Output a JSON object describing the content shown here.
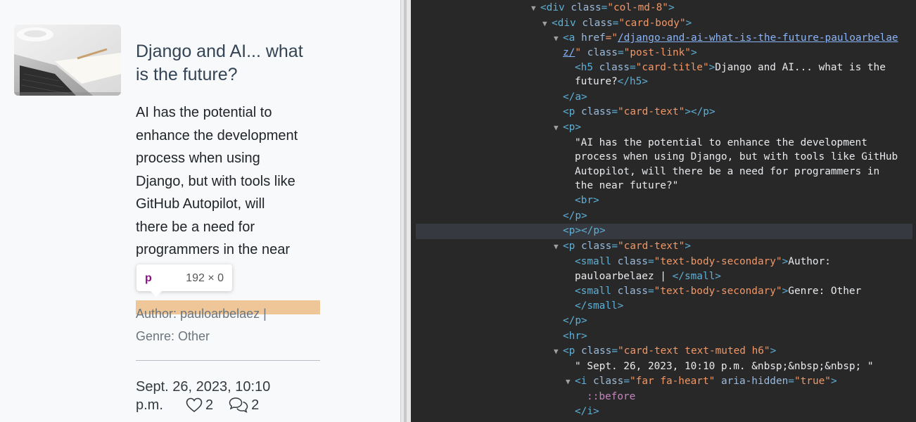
{
  "post": {
    "image_alt": "laptop with notebook and pencil on desk",
    "title_line1": "Django and AI... what",
    "title_line2": "is the future?",
    "body_lines": [
      "AI has the potential to",
      "enhance the development",
      "process when using",
      "Django, but with tools like",
      "GitHub Autopilot, will",
      "there be a need for",
      "programmers in the near"
    ],
    "author_line": "Author: pauloarbelaez |",
    "genre_line": "Genre: Other",
    "date_line1": "Sept. 26, 2023, 10:10",
    "date_line2": "p.m.",
    "likes": "2",
    "comments": "2"
  },
  "tooltip": {
    "tag": "p",
    "dims": "192 × 0"
  },
  "devtools": {
    "lines": {
      "l1_tag": "<div ",
      "l1_attr": "class",
      "l1_val": "\"col-md-8\"",
      "l1_end": ">",
      "l2_tag": "<div ",
      "l2_attr": "class",
      "l2_val": "\"card-body\"",
      "l2_end": ">",
      "l3_tag": "<a ",
      "l3_attr": "href",
      "l3_eq": "=\"",
      "l3_link": "/django-and-ai-what-is-the-future-pauloarbelae",
      "l4_link": "z/",
      "l4_q": "\" ",
      "l4_attr": "class",
      "l4_val": "\"post-link\"",
      "l4_end": ">",
      "l5_tag": "<h5 ",
      "l5_attr": "class",
      "l5_val": "\"card-title\"",
      "l5_end": ">",
      "l5_text": "Django and AI... what is the",
      "l6_text": "future?",
      "l6_end": "</h5>",
      "l7": "</a>",
      "l8_tag": "<p ",
      "l8_attr": "class",
      "l8_val": "\"card-text\"",
      "l8_end": "></p>",
      "l9": "<p>",
      "l10": "\"AI has the potential to enhance the development",
      "l11": "process when using Django, but with tools like GitHub",
      "l12": "Autopilot, will there be a need for programmers in",
      "l13": "the near future?\"",
      "l14": "<br>",
      "l15": "</p>",
      "l16": "<p></p>",
      "l17_tag": "<p ",
      "l17_attr": "class",
      "l17_val": "\"card-text\"",
      "l17_end": ">",
      "l18_tag": "<small ",
      "l18_attr": "class",
      "l18_val": "\"text-body-secondary\"",
      "l18_end": ">",
      "l18_text": "Author:",
      "l19_text": "pauloarbelaez | ",
      "l19_end": "</small>",
      "l20_tag": "<small ",
      "l20_attr": "class",
      "l20_val": "\"text-body-secondary\"",
      "l20_end": ">",
      "l20_text": "Genre: Other",
      "l21": "</small>",
      "l22": "</p>",
      "l23": "<hr>",
      "l24_tag": "<p ",
      "l24_attr": "class",
      "l24_val": "\"card-text text-muted h6\"",
      "l24_end": ">",
      "l25": "\" Sept. 26, 2023, 10:10 p.m. &nbsp;&nbsp;&nbsp; \"",
      "l26_tag": "<i ",
      "l26_attr": "class",
      "l26_val": "\"far fa-heart\"",
      "l26_attr2": "aria-hidden",
      "l26_val2": "\"true\"",
      "l26_end": ">",
      "l27": "::before",
      "l28": "</i>"
    }
  },
  "colors": {
    "devtools_bg": "#282828",
    "tag": "#5db0d7",
    "attr_name": "#9bbbdc",
    "attr_value": "#f29766",
    "link": "#8ab4f8",
    "pseudo": "#c586c0",
    "highlight": "#e8aa64"
  }
}
